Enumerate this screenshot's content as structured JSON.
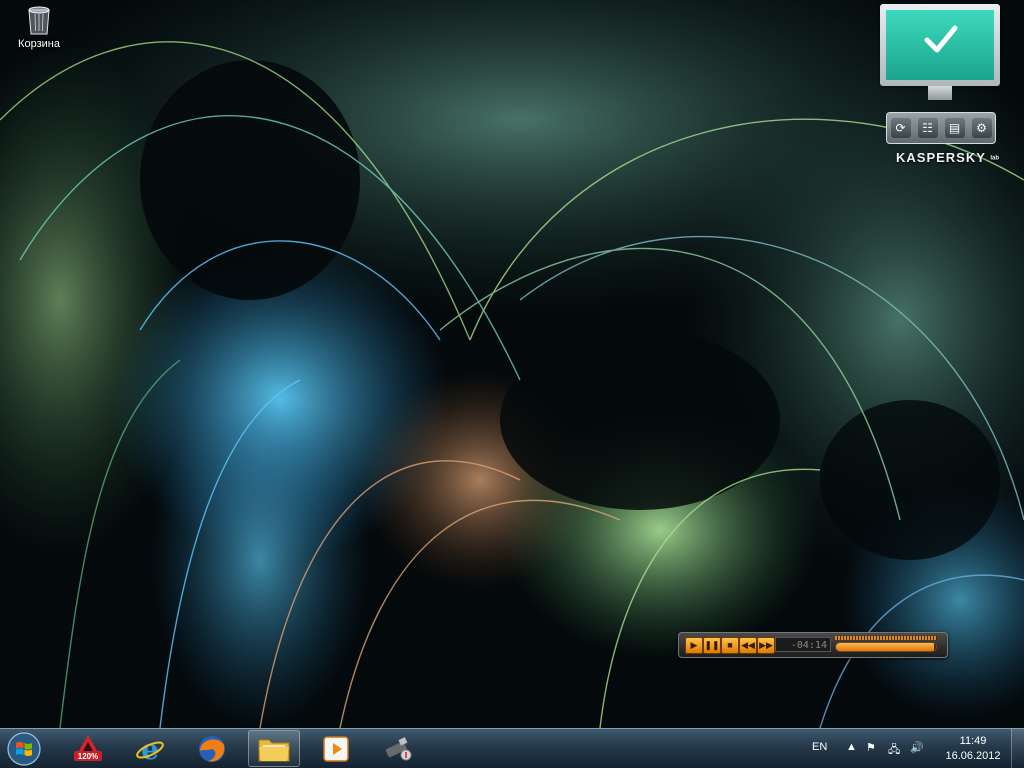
{
  "desktop": {
    "icons": [
      {
        "label": "Корзина",
        "icon": "recycle-bin-icon"
      }
    ]
  },
  "kaspersky_gadget": {
    "brand": "KASPERSKY",
    "brand_suffix": "lab",
    "status": "protected",
    "status_icon": "checkmark-icon",
    "buttons": [
      "update-icon",
      "tasks-icon",
      "reports-icon",
      "settings-icon"
    ],
    "accent_color": "#2cc5a8"
  },
  "media_player": {
    "time": "-04:14",
    "buttons": [
      "play-icon",
      "pause-icon",
      "stop-icon",
      "previous-icon",
      "next-icon"
    ],
    "progress": 0.98,
    "accent_color": "#f39c1a"
  },
  "taskbar": {
    "pinned": [
      {
        "name": "autocad",
        "icon": "autocad-120-icon",
        "badge": "120%"
      },
      {
        "name": "internet-explorer",
        "icon": "internet-explorer-icon"
      },
      {
        "name": "firefox",
        "icon": "firefox-icon"
      },
      {
        "name": "windows-explorer",
        "icon": "folder-icon"
      },
      {
        "name": "media-player",
        "icon": "media-player-icon"
      },
      {
        "name": "usb-app",
        "icon": "usb-drive-icon"
      }
    ],
    "tray": {
      "language": "EN",
      "time": "11:49",
      "date": "16.06.2012"
    }
  }
}
